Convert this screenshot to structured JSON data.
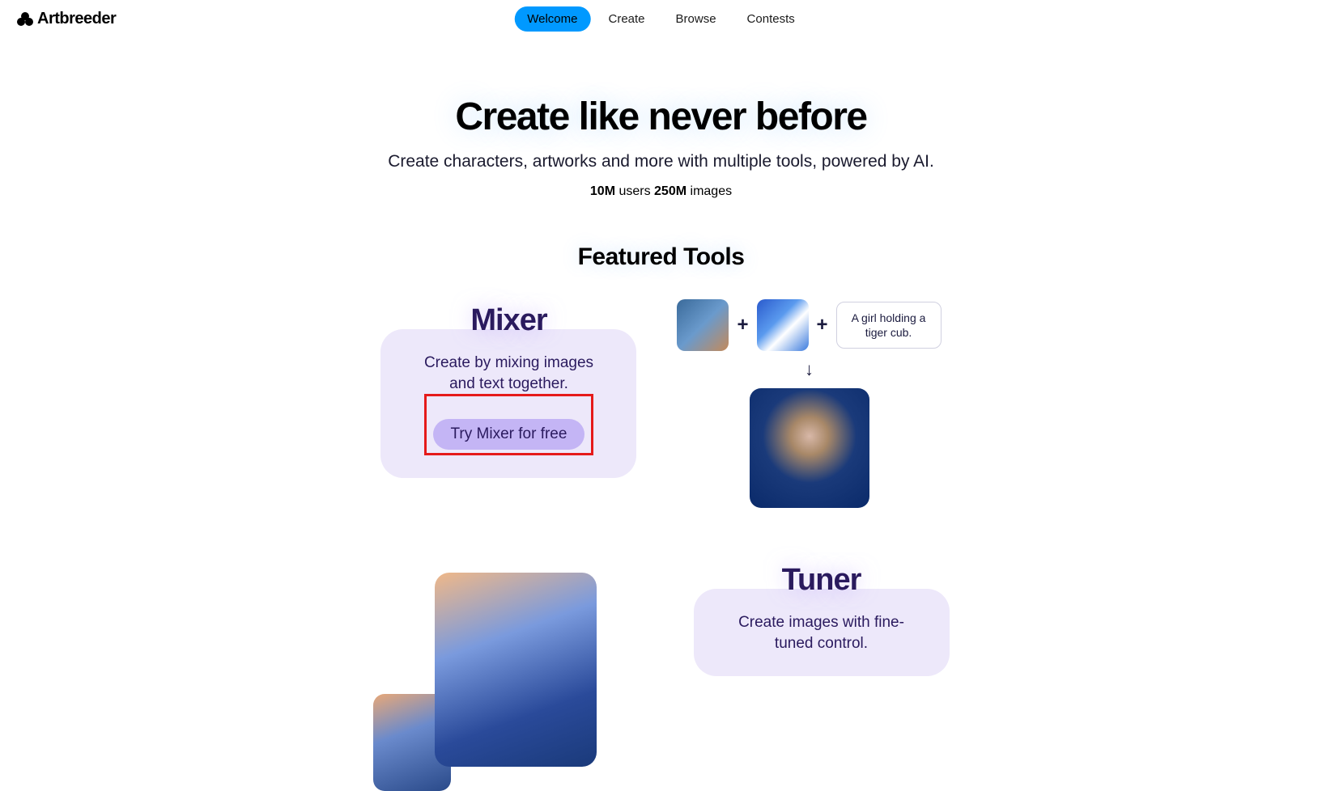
{
  "brand": "Artbreeder",
  "nav": {
    "items": [
      "Welcome",
      "Create",
      "Browse",
      "Contests"
    ],
    "active_index": 0
  },
  "hero": {
    "title": "Create like never before",
    "subtitle": "Create characters, artworks and more with multiple tools, powered by AI.",
    "stat1_value": "10M",
    "stat1_label": " users  ",
    "stat2_value": "250M",
    "stat2_label": " images"
  },
  "featured": {
    "title": "Featured Tools"
  },
  "mixer": {
    "name": "Mixer",
    "desc": "Create by mixing images and text together.",
    "cta": "Try Mixer for free",
    "prompt": "A girl holding a tiger cub.",
    "plus": "+",
    "arrow": "↓"
  },
  "tuner": {
    "name": "Tuner",
    "desc": "Create images with fine-tuned control."
  }
}
